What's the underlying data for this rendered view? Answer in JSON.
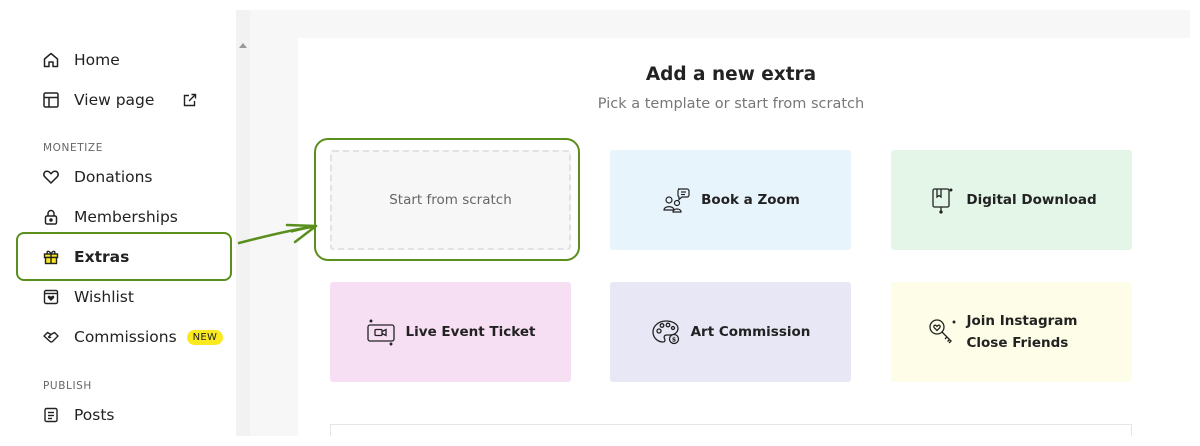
{
  "sidebar": {
    "items_top": [
      {
        "label": "Home",
        "icon": "home-icon"
      },
      {
        "label": "View page",
        "icon": "layout-icon"
      }
    ],
    "monetize_label": "MONETIZE",
    "monetize_items": [
      {
        "label": "Donations",
        "icon": "heart-icon"
      },
      {
        "label": "Memberships",
        "icon": "lock-icon"
      },
      {
        "label": "Extras",
        "icon": "gift-icon",
        "active": true
      },
      {
        "label": "Wishlist",
        "icon": "wishlist-icon"
      },
      {
        "label": "Commissions",
        "icon": "handshake-icon",
        "badge": "NEW"
      }
    ],
    "publish_label": "PUBLISH",
    "publish_items": [
      {
        "label": "Posts",
        "icon": "document-icon"
      }
    ]
  },
  "main": {
    "title": "Add a new extra",
    "subtitle": "Pick a template or start from scratch",
    "cards": [
      {
        "label": "Start from scratch"
      },
      {
        "label": "Book a Zoom",
        "icon": "people-chat-icon",
        "color": "#e8f4fc"
      },
      {
        "label": "Digital Download",
        "icon": "download-book-icon",
        "color": "#e3f6e8"
      },
      {
        "label": "Live Event Ticket",
        "icon": "video-camera-icon",
        "color": "#f7dff3"
      },
      {
        "label": "Art Commission",
        "icon": "palette-icon",
        "color": "#e7e7f5"
      },
      {
        "label": "Join Instagram Close Friends",
        "icon": "key-heart-icon",
        "color": "#fdfde8"
      }
    ]
  },
  "colors": {
    "annotation_green": "#5a8f1e",
    "badge_yellow": "#fbe91f"
  }
}
